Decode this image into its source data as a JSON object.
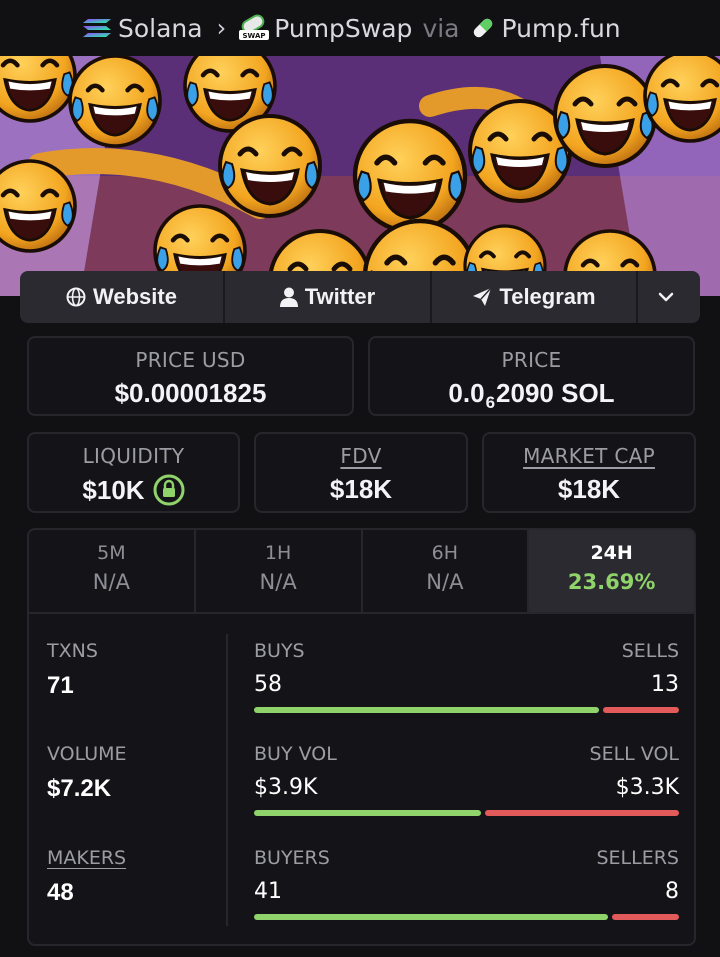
{
  "breadcrumb": {
    "chain": "Solana",
    "dex": "PumpSwap",
    "via": "via",
    "launchpad": "Pump.fun",
    "icons": [
      "solana-icon",
      "chevron-right-icon",
      "pumpswap-icon",
      "pill-icon"
    ]
  },
  "links": {
    "website": "Website",
    "twitter": "Twitter",
    "telegram": "Telegram",
    "more_icon": "chevron-down-icon"
  },
  "prices": {
    "price_usd_label": "PRICE USD",
    "price_usd": "$0.00001825",
    "price_label": "PRICE",
    "price_prefix": "0.0",
    "price_zeros": "6",
    "price_suffix": "2090 SOL"
  },
  "metrics": {
    "liquidity_label": "LIQUIDITY",
    "liquidity": "$10K",
    "fdv_label": "FDV",
    "fdv": "$18K",
    "mcap_label": "MARKET CAP",
    "mcap": "$18K"
  },
  "tabs": [
    {
      "label": "5M",
      "value": "N/A",
      "active": false
    },
    {
      "label": "1H",
      "value": "N/A",
      "active": false
    },
    {
      "label": "6H",
      "value": "N/A",
      "active": false
    },
    {
      "label": "24H",
      "value": "23.69%",
      "active": true
    }
  ],
  "stats": {
    "txns_label": "TXNS",
    "txns": "71",
    "buys_label": "BUYS",
    "buys": "58",
    "sells_label": "SELLS",
    "sells": "13",
    "volume_label": "VOLUME",
    "volume": "$7.2K",
    "buy_vol_label": "BUY VOL",
    "buy_vol": "$3.9K",
    "sell_vol_label": "SELL VOL",
    "sell_vol": "$3.3K",
    "makers_label": "MAKERS",
    "makers": "48",
    "buyers_label": "BUYERS",
    "buyers": "41",
    "sellers_label": "SELLERS",
    "sellers": "8"
  },
  "ratios": {
    "buys_share": 0.82,
    "vol_share": 0.54,
    "buyers_share": 0.84
  },
  "colors": {
    "positive": "#8fd36a",
    "negative": "#e35a5a",
    "background": "#111114"
  }
}
